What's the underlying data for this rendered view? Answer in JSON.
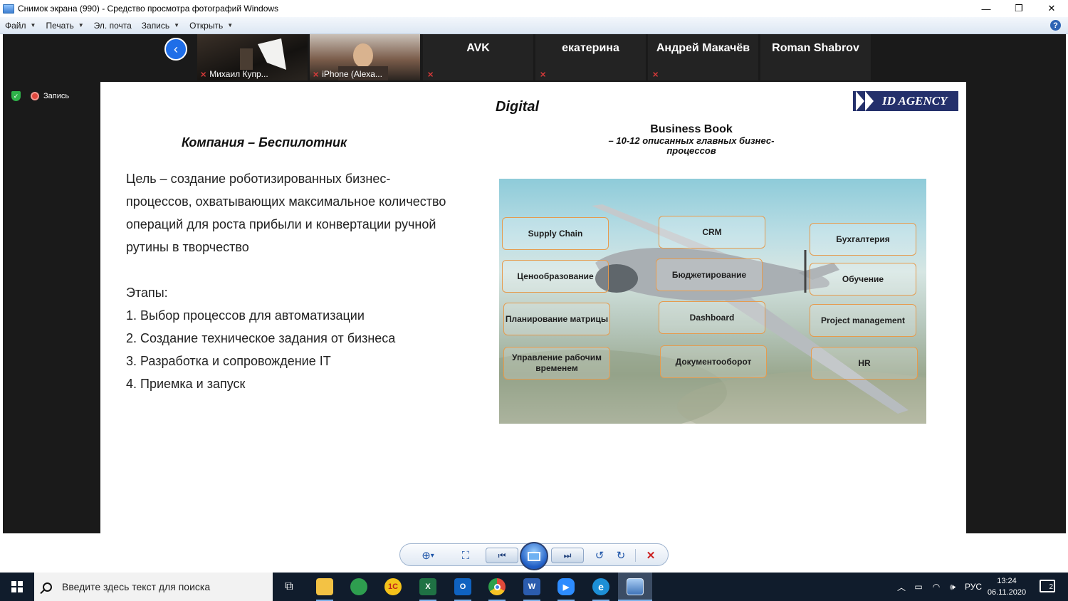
{
  "window": {
    "title": "Снимок экрана (990) - Средство просмотра фотографий Windows",
    "minimize": "—",
    "maximize": "❐",
    "close": "✕"
  },
  "menu": {
    "items": [
      {
        "label": "Файл",
        "has_caret": true
      },
      {
        "label": "Печать",
        "has_caret": true
      },
      {
        "label": "Эл. почта",
        "has_caret": false
      },
      {
        "label": "Запись",
        "has_caret": true
      },
      {
        "label": "Открыть",
        "has_caret": true
      }
    ],
    "caret": "▼",
    "help": "?"
  },
  "meeting": {
    "back_icon": "‹",
    "participants": [
      {
        "name": "Михаил Купр...",
        "type": "video-dark"
      },
      {
        "name": "iPhone (Alexa...",
        "type": "video-light"
      },
      {
        "name": "AVK",
        "type": "name"
      },
      {
        "name": "екатерина",
        "type": "name"
      },
      {
        "name": "Андрей Макачёв",
        "type": "name"
      },
      {
        "name": "Roman Shabrov",
        "type": "name"
      }
    ],
    "mic_icon": "⨯",
    "recording_label": "Запись",
    "shield_icon": "✓"
  },
  "slide": {
    "digital_label": "Digital",
    "logo_text": "ID AGENCY",
    "heading": "Компания – Беспилотник",
    "business_book_title": "Business Book",
    "business_book_sub_1": "– 10-12 описанных главных бизнес-",
    "business_book_sub_2": "процессов",
    "goal_text": "Цель – создание роботизированных бизнес-процессов, охватывающих максимальное количество операций для роста прибыли и конвертации ручной рутины в творчество",
    "stages_title": "Этапы:",
    "stages": [
      "1. Выбор процессов для автоматизации",
      "2. Создание техническое задания от бизнеса",
      "3. Разработка и сопровождение IT",
      "4. Приемка и запуск"
    ],
    "processes": [
      "Supply Chain",
      "CRM",
      "Бухгалтерия",
      "Ценообразование",
      "Бюджетирование",
      "Обучение",
      "Планирование матрицы",
      "Dashboard",
      "Project management",
      "Управление рабочим временем",
      "Документооборот",
      "HR"
    ]
  },
  "viewer_toolbar": {
    "zoom_icon": "⊕",
    "zoom_caret": "▾",
    "fit_icon": "⛶",
    "prev_icon": "⏮",
    "next_icon": "⏭",
    "rotate_left_icon": "↺",
    "rotate_right_icon": "↻",
    "delete_icon": "✕"
  },
  "taskbar": {
    "search_placeholder": "Введите здесь текст для поиска",
    "apps": [
      {
        "name": "task-view",
        "label": "⧉",
        "color": "#101c2c"
      },
      {
        "name": "file-explorer",
        "label": "",
        "color": "#f3c244"
      },
      {
        "name": "maps",
        "label": "",
        "color": "#2e9e4f"
      },
      {
        "name": "1c",
        "label": "1С",
        "color": "#f4c21a"
      },
      {
        "name": "excel",
        "label": "X",
        "color": "#1f7244"
      },
      {
        "name": "outlook",
        "label": "O",
        "color": "#0f62c0"
      },
      {
        "name": "chrome",
        "label": "",
        "color": "#e04a3a"
      },
      {
        "name": "word",
        "label": "W",
        "color": "#2b5cae"
      },
      {
        "name": "zoom",
        "label": "▶",
        "color": "#2d8cff"
      },
      {
        "name": "edge",
        "label": "e",
        "color": "#1d8fd6"
      },
      {
        "name": "photo-viewer",
        "label": "",
        "color": "#5a88c6"
      }
    ],
    "tray": {
      "chevron": "︿",
      "battery": "▭",
      "wifi": "◠",
      "volume": "🕪",
      "language": "РУС"
    },
    "time": "13:24",
    "date": "06.11.2020",
    "notifications_count": "2"
  }
}
